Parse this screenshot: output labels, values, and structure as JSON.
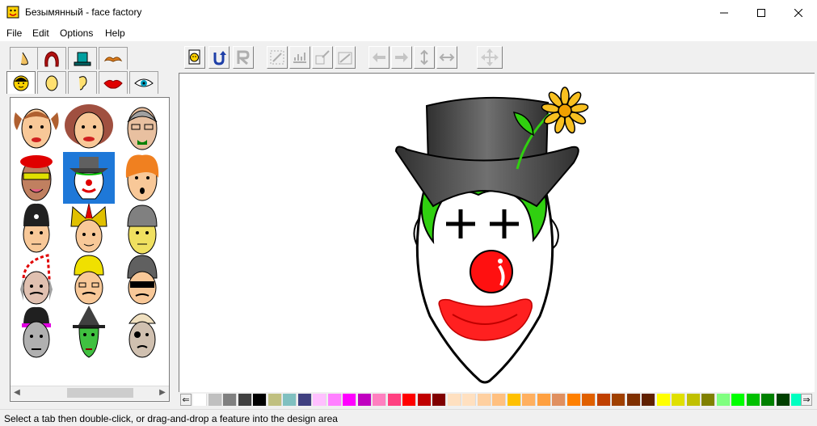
{
  "window": {
    "title": "Безымянный - face factory",
    "controls": [
      "minimize",
      "maximize",
      "close"
    ]
  },
  "menu": {
    "items": [
      "File",
      "Edit",
      "Options",
      "Help"
    ]
  },
  "toolbar": {
    "buttons": [
      {
        "icon": "new-face-icon",
        "enabled": true
      },
      {
        "icon": "undo-icon",
        "enabled": true
      },
      {
        "icon": "redo-icon",
        "enabled": false
      },
      {
        "icon": "scale-down-icon",
        "enabled": false
      },
      {
        "icon": "scale-up-icon",
        "enabled": false
      },
      {
        "icon": "shrink-icon",
        "enabled": false
      },
      {
        "icon": "grow-icon",
        "enabled": false
      },
      {
        "icon": "move-left-icon",
        "enabled": false
      },
      {
        "icon": "move-right-icon",
        "enabled": false
      },
      {
        "icon": "flip-vertical-icon",
        "enabled": false
      },
      {
        "icon": "flip-horizontal-icon",
        "enabled": false
      },
      {
        "icon": "move-all-icon",
        "enabled": false
      }
    ]
  },
  "feature_tabs": {
    "row1": [
      "nose-tab",
      "hair-tab",
      "hat-tab",
      "moustache-tab"
    ],
    "row2": [
      "face-tab",
      "head-shape-tab",
      "ear-tab",
      "lips-tab",
      "eye-tab"
    ],
    "active": "face-tab"
  },
  "gallery": {
    "items": [
      "face-pigtails",
      "face-curly-hair",
      "face-old-man",
      "face-red-beret-sunglasses",
      "face-clown",
      "face-orange-hair",
      "face-police-helmet",
      "face-jester",
      "face-grey-cap",
      "face-striped-hat",
      "face-yellow-helmet",
      "face-goggles",
      "face-punk",
      "face-witch",
      "face-pirate"
    ],
    "selected_index": 4
  },
  "canvas": {
    "subject": "clown face with black top hat and yellow flower"
  },
  "palette": {
    "colors": [
      "#ffffff",
      "#c0c0c0",
      "#808080",
      "#404040",
      "#000000",
      "#c0c080",
      "#80c0c0",
      "#404080",
      "#ffc0ff",
      "#ff80ff",
      "#ff00ff",
      "#c000c0",
      "#ff80c0",
      "#ff4080",
      "#ff0000",
      "#c00000",
      "#800000",
      "#ffe0c0",
      "#ffe0c0",
      "#ffd0a0",
      "#ffc080",
      "#ffc000",
      "#ffb060",
      "#ffa040",
      "#e09060",
      "#ff8000",
      "#e06000",
      "#c04000",
      "#a04000",
      "#803000",
      "#602000",
      "#ffff00",
      "#e0e000",
      "#c0c000",
      "#808000",
      "#80ff80",
      "#00ff00",
      "#00c000",
      "#008000",
      "#004000",
      "#00ffc0"
    ]
  },
  "status": {
    "text": "Select a tab then double-click, or drag-and-drop a feature into the design area"
  }
}
